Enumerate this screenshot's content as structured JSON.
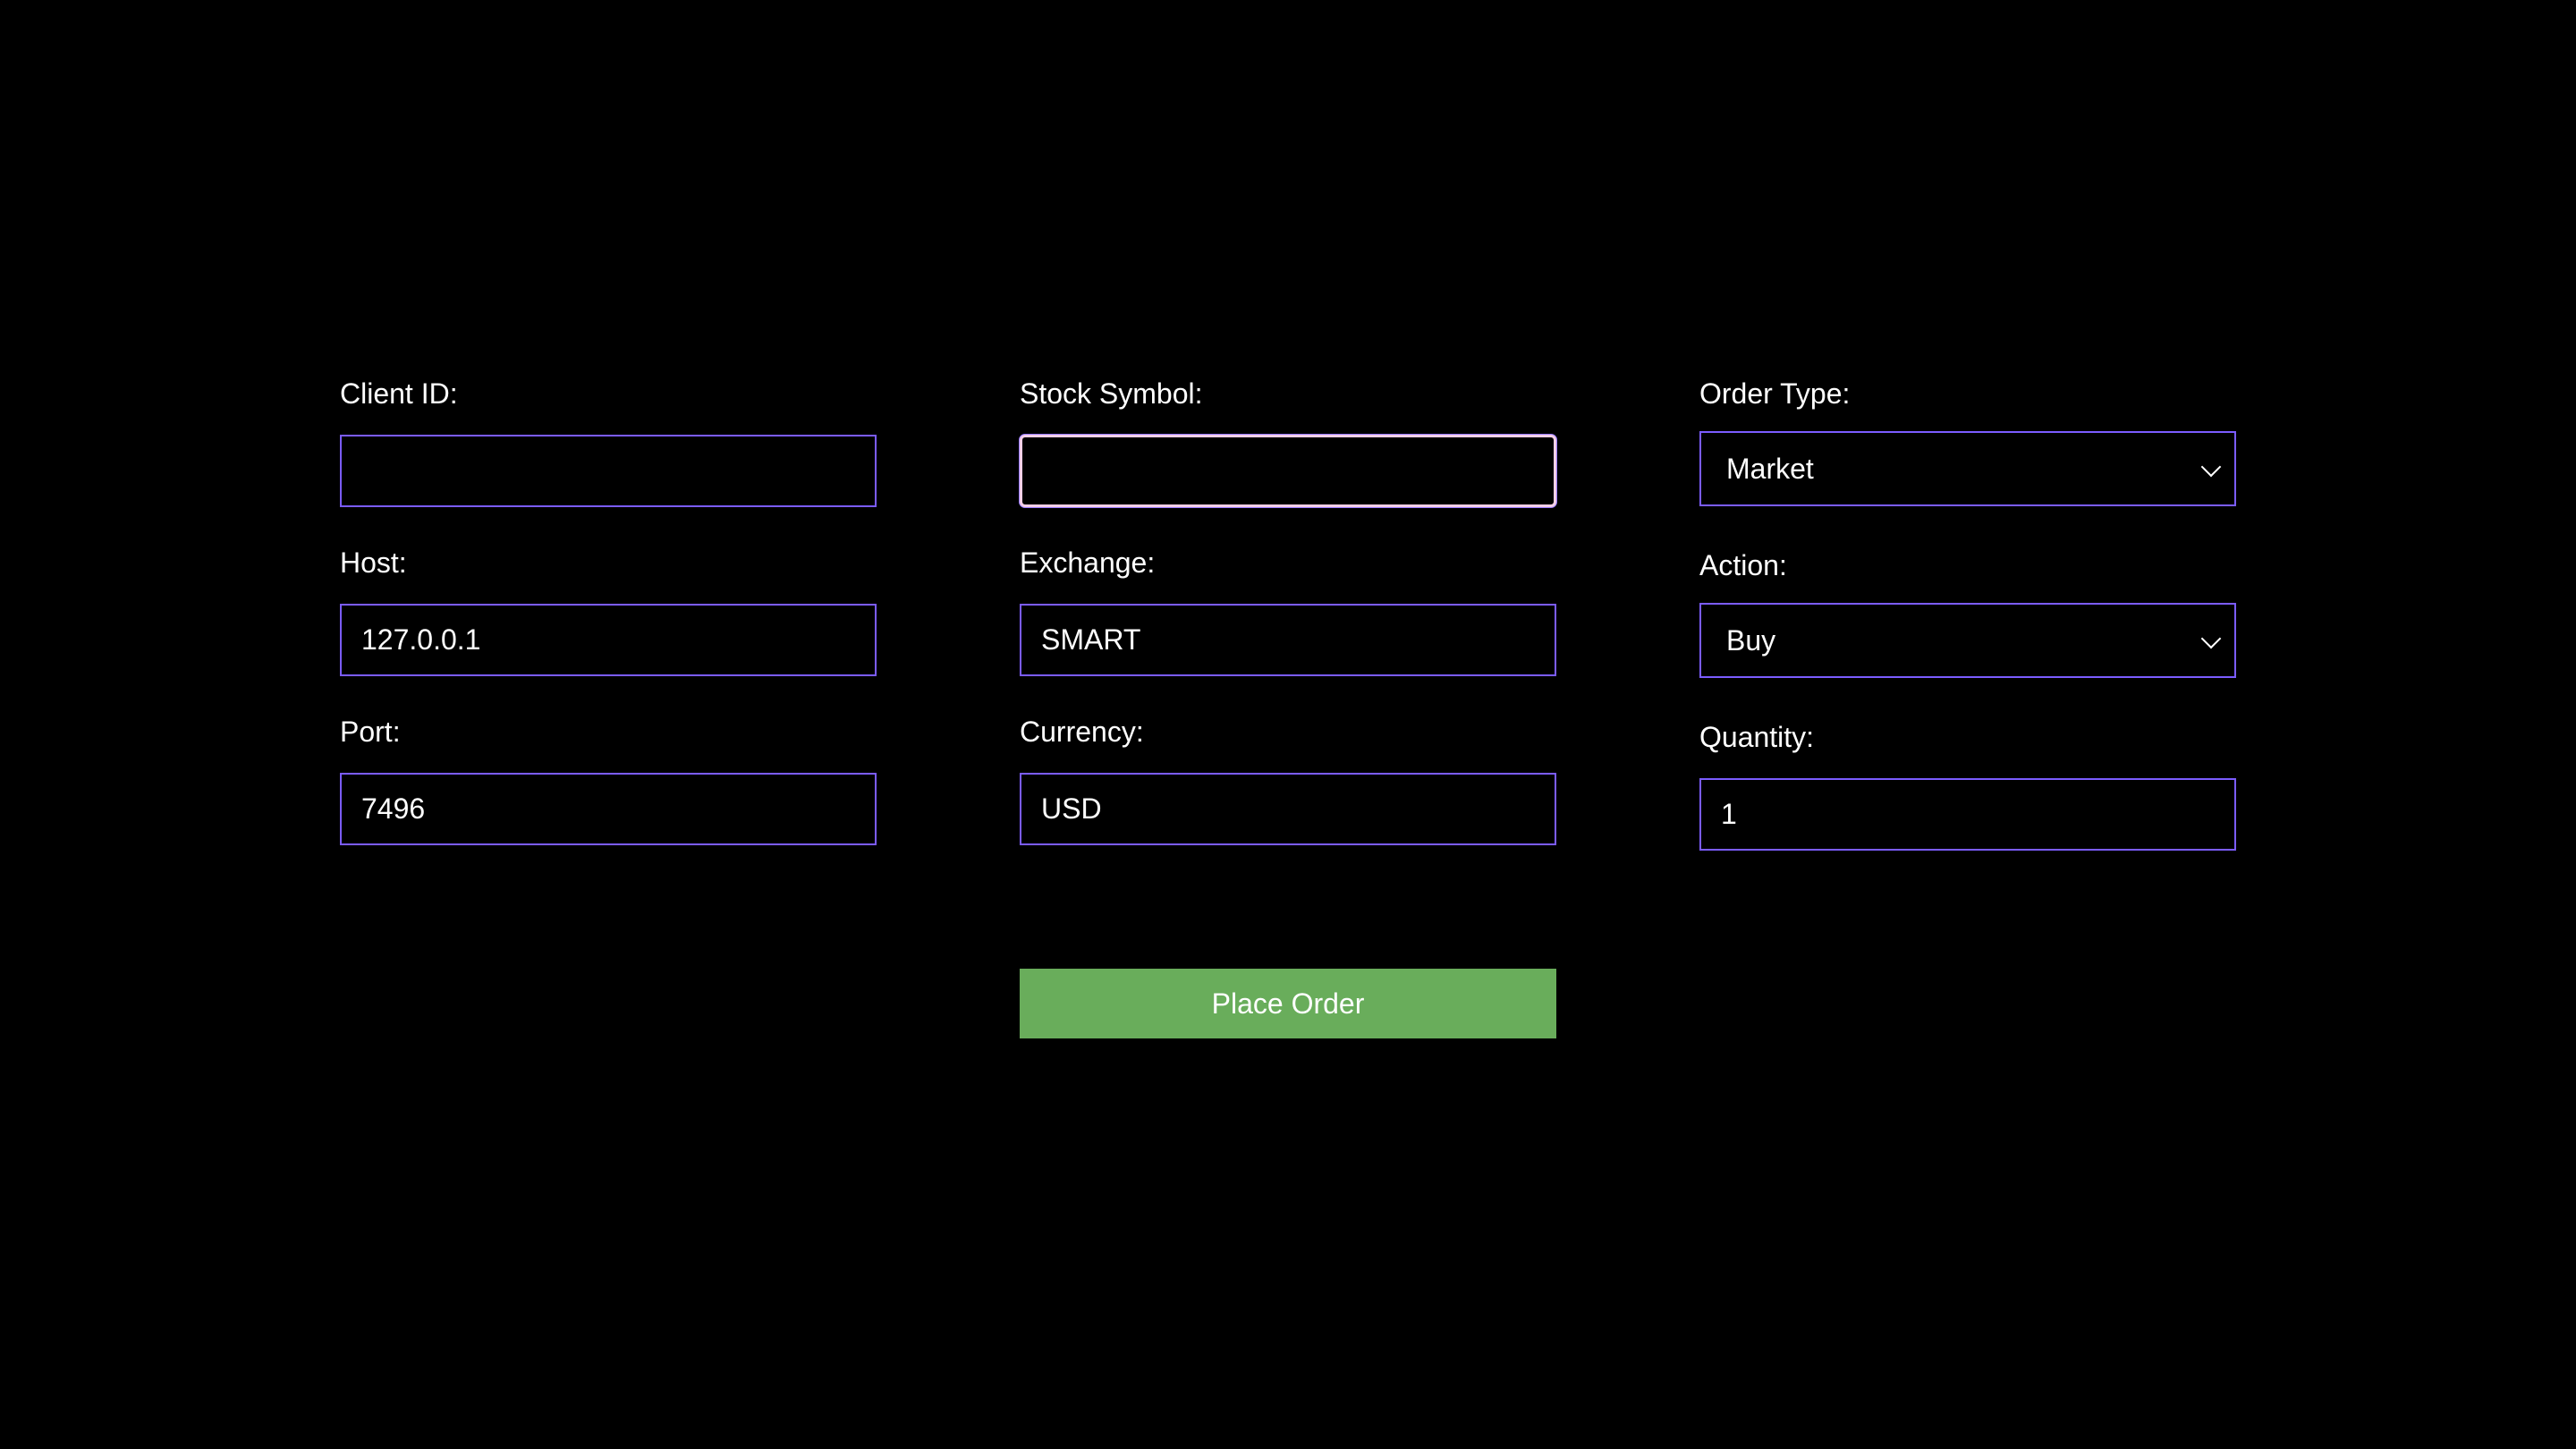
{
  "form": {
    "client_id": {
      "label": "Client ID:",
      "value": ""
    },
    "host": {
      "label": "Host:",
      "value": "127.0.0.1"
    },
    "port": {
      "label": "Port:",
      "value": "7496"
    },
    "stock_symbol": {
      "label": "Stock Symbol:",
      "value": ""
    },
    "exchange": {
      "label": "Exchange:",
      "value": "SMART"
    },
    "currency": {
      "label": "Currency:",
      "value": "USD"
    },
    "order_type": {
      "label": "Order Type:",
      "selected": "Market"
    },
    "action": {
      "label": "Action:",
      "selected": "Buy"
    },
    "quantity": {
      "label": "Quantity:",
      "value": "1"
    }
  },
  "buttons": {
    "place_order": "Place Order"
  },
  "colors": {
    "background": "#000000",
    "input_border": "#7b5cff",
    "focus_border": "#f5cfe8",
    "button_bg": "#69ad5b",
    "text": "#ffffff"
  },
  "icons": {
    "select_chevron": "chevron-down-icon"
  }
}
